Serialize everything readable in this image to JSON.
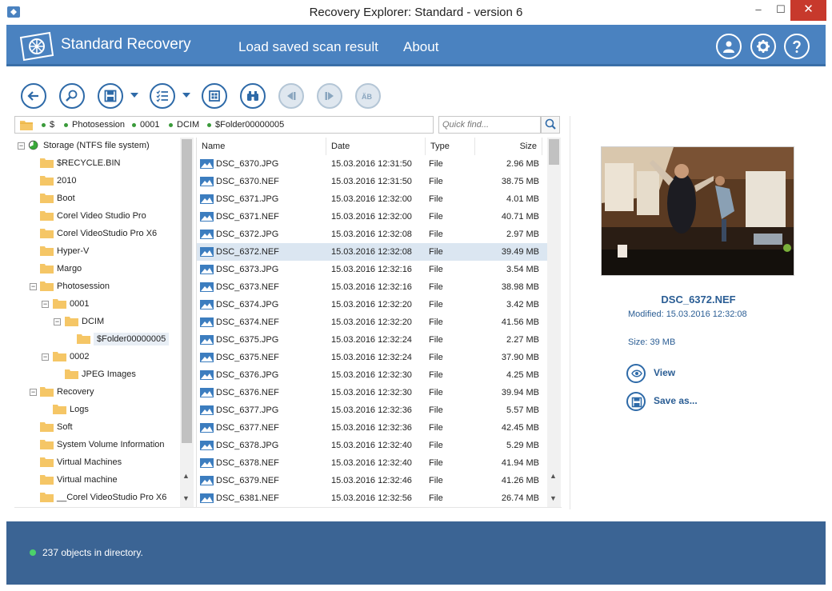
{
  "window": {
    "title": "Recovery Explorer: Standard - version 6",
    "min": "–",
    "max": "☐",
    "close": "✕"
  },
  "header": {
    "brand": "Standard Recovery",
    "nav_load": "Load saved scan result",
    "nav_about": "About",
    "accent": "#4a82c0"
  },
  "path": {
    "crumbs": [
      "$",
      "Photosession",
      "0001",
      "DCIM",
      "$Folder00000005"
    ],
    "quickfind_placeholder": "Quick find..."
  },
  "tree": {
    "root": "Storage (NTFS file system)",
    "items": [
      {
        "label": "$RECYCLE.BIN"
      },
      {
        "label": "2010"
      },
      {
        "label": "Boot"
      },
      {
        "label": "Corel Video Studio Pro"
      },
      {
        "label": "Corel VideoStudio Pro X6"
      },
      {
        "label": "Hyper-V"
      },
      {
        "label": "Margo"
      },
      {
        "label": "Photosession"
      },
      {
        "label": "0001"
      },
      {
        "label": "DCIM"
      },
      {
        "label": "$Folder00000005"
      },
      {
        "label": "0002"
      },
      {
        "label": "JPEG Images"
      },
      {
        "label": "Recovery"
      },
      {
        "label": "Logs"
      },
      {
        "label": "Soft"
      },
      {
        "label": "System Volume Information"
      },
      {
        "label": "Virtual Machines"
      },
      {
        "label": "Virtual machine"
      },
      {
        "label": "__Corel VideoStudio Pro X6"
      }
    ]
  },
  "list": {
    "columns": {
      "name": "Name",
      "date": "Date",
      "type": "Type",
      "size": "Size"
    },
    "rows": [
      {
        "name": "DSC_6370.JPG",
        "date": "15.03.2016 12:31:50",
        "type": "File",
        "size": "2.96 MB"
      },
      {
        "name": "DSC_6370.NEF",
        "date": "15.03.2016 12:31:50",
        "type": "File",
        "size": "38.75 MB"
      },
      {
        "name": "DSC_6371.JPG",
        "date": "15.03.2016 12:32:00",
        "type": "File",
        "size": "4.01 MB"
      },
      {
        "name": "DSC_6371.NEF",
        "date": "15.03.2016 12:32:00",
        "type": "File",
        "size": "40.71 MB"
      },
      {
        "name": "DSC_6372.JPG",
        "date": "15.03.2016 12:32:08",
        "type": "File",
        "size": "2.97 MB"
      },
      {
        "name": "DSC_6372.NEF",
        "date": "15.03.2016 12:32:08",
        "type": "File",
        "size": "39.49 MB"
      },
      {
        "name": "DSC_6373.JPG",
        "date": "15.03.2016 12:32:16",
        "type": "File",
        "size": "3.54 MB"
      },
      {
        "name": "DSC_6373.NEF",
        "date": "15.03.2016 12:32:16",
        "type": "File",
        "size": "38.98 MB"
      },
      {
        "name": "DSC_6374.JPG",
        "date": "15.03.2016 12:32:20",
        "type": "File",
        "size": "3.42 MB"
      },
      {
        "name": "DSC_6374.NEF",
        "date": "15.03.2016 12:32:20",
        "type": "File",
        "size": "41.56 MB"
      },
      {
        "name": "DSC_6375.JPG",
        "date": "15.03.2016 12:32:24",
        "type": "File",
        "size": "2.27 MB"
      },
      {
        "name": "DSC_6375.NEF",
        "date": "15.03.2016 12:32:24",
        "type": "File",
        "size": "37.90 MB"
      },
      {
        "name": "DSC_6376.JPG",
        "date": "15.03.2016 12:32:30",
        "type": "File",
        "size": "4.25 MB"
      },
      {
        "name": "DSC_6376.NEF",
        "date": "15.03.2016 12:32:30",
        "type": "File",
        "size": "39.94 MB"
      },
      {
        "name": "DSC_6377.JPG",
        "date": "15.03.2016 12:32:36",
        "type": "File",
        "size": "5.57 MB"
      },
      {
        "name": "DSC_6377.NEF",
        "date": "15.03.2016 12:32:36",
        "type": "File",
        "size": "42.45 MB"
      },
      {
        "name": "DSC_6378.JPG",
        "date": "15.03.2016 12:32:40",
        "type": "File",
        "size": "5.29 MB"
      },
      {
        "name": "DSC_6378.NEF",
        "date": "15.03.2016 12:32:40",
        "type": "File",
        "size": "41.94 MB"
      },
      {
        "name": "DSC_6379.NEF",
        "date": "15.03.2016 12:32:46",
        "type": "File",
        "size": "41.26 MB"
      },
      {
        "name": "DSC_6381.NEF",
        "date": "15.03.2016 12:32:56",
        "type": "File",
        "size": "26.74 MB"
      }
    ]
  },
  "preview": {
    "name": "DSC_6372.NEF",
    "modified": "Modified: 15.03.2016 12:32:08",
    "size": "Size: 39 MB",
    "view_label": "View",
    "saveas_label": "Save as..."
  },
  "status": {
    "text": "237 objects in directory.",
    "bar_color": "#3b6494",
    "dot_color": "#4cd26a"
  },
  "icons": {
    "toolbar": [
      "back-icon",
      "zoom-icon",
      "save-icon",
      "checklist-icon",
      "tile-icon",
      "binoculars-icon",
      "prev-icon",
      "next-icon",
      "case-icon"
    ]
  }
}
